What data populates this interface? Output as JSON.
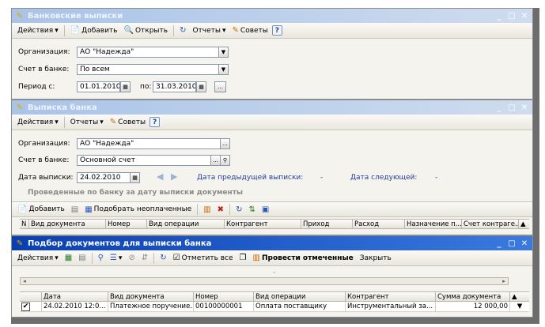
{
  "win1": {
    "title": "Банковские выписки",
    "toolbar": {
      "actions": "Действия",
      "add": "Добавить",
      "open": "Открыть",
      "reports": "Отчеты",
      "tips": "Советы",
      "help": "?"
    },
    "org_label": "Организация:",
    "org_value": "АО \"Надежда\"",
    "account_label": "Счет в банке:",
    "account_value": "По всем",
    "period_label": "Период с:",
    "period_from": "01.01.2010",
    "period_to_label": "по:",
    "period_to": "31.03.2010",
    "ellipsis": "..."
  },
  "win2": {
    "title": "Выписка банка",
    "toolbar": {
      "actions": "Действия",
      "reports": "Отчеты",
      "tips": "Советы",
      "help": "?"
    },
    "org_label": "Организация:",
    "org_value": "АО \"Надежда\"",
    "account_label": "Счет в банке:",
    "account_value": "Основной счет",
    "date_label": "Дата выписки:",
    "date_value": "24.02.2010",
    "prev_label": "Дата предыдущей выписки:",
    "prev_value": "-",
    "next_label": "Дата следующей:",
    "next_value": "-",
    "section_title": "Проведенные по банку за дату выписки документы",
    "grid_toolbar": {
      "add": "Добавить",
      "pick": "Подобрать неоплаченные"
    },
    "columns": [
      "N",
      "Вид документа",
      "Номер",
      "Вид операции",
      "Контрагент",
      "Приход",
      "Расход",
      "Назначение п...",
      "Счет контраге..."
    ],
    "ellipsis": "..."
  },
  "win3": {
    "title": "Подбор документов для выписки банка",
    "toolbar": {
      "actions": "Действия",
      "mark_all": "Отметить все",
      "post_marked": "Провести отмеченные",
      "close": "Закрыть"
    },
    "columns": [
      "",
      "Дата",
      "Вид документа",
      "Номер",
      "Вид операции",
      "Контрагент",
      "Сумма документа"
    ],
    "rows": [
      {
        "date": "24.02.2010 12:0...",
        "doc_type": "Платежное поручение...",
        "number": "00100000001",
        "operation": "Оплата поставщику",
        "counterparty": "Инструментальный за...",
        "amount": "12 000,00"
      }
    ],
    "gray_dash": "-"
  }
}
